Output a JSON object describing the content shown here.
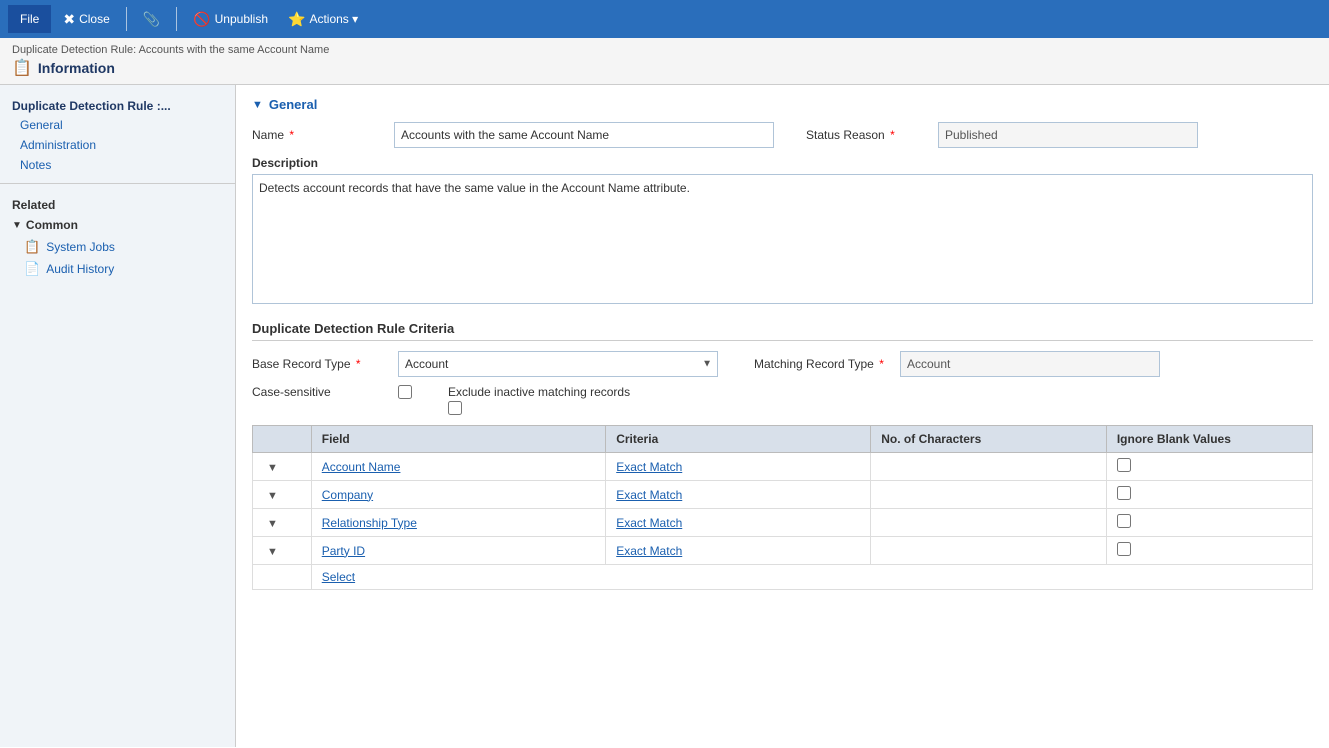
{
  "toolbar": {
    "file_label": "File",
    "close_label": "Close",
    "attachment_icon": "📎",
    "unpublish_label": "Unpublish",
    "actions_label": "Actions ▾"
  },
  "breadcrumb": {
    "text": "Duplicate Detection Rule: Accounts with the same Account Name"
  },
  "page_title": "Information",
  "sidebar": {
    "section_label": "Duplicate Detection Rule :...",
    "nav_items": [
      {
        "label": "General"
      },
      {
        "label": "Administration"
      },
      {
        "label": "Notes"
      }
    ],
    "related_label": "Related",
    "common_label": "Common",
    "common_items": [
      {
        "label": "System Jobs",
        "icon": "📋"
      },
      {
        "label": "Audit History",
        "icon": "📄"
      }
    ]
  },
  "general_section": {
    "title": "General",
    "name_label": "Name",
    "name_value": "Accounts with the same Account Name",
    "status_label": "Status Reason",
    "status_value": "Published",
    "description_label": "Description",
    "description_value": "Detects account records that have the same value in the Account Name attribute."
  },
  "criteria_section": {
    "title": "Duplicate Detection Rule Criteria",
    "base_record_label": "Base Record Type",
    "base_record_value": "Account",
    "matching_record_label": "Matching Record Type",
    "matching_record_value": "Account",
    "case_sensitive_label": "Case-sensitive",
    "exclude_inactive_label": "Exclude inactive matching records",
    "table_headers": [
      "",
      "Field",
      "Criteria",
      "No. of Characters",
      "Ignore Blank Values"
    ],
    "table_rows": [
      {
        "field": "Account Name",
        "criteria": "Exact Match"
      },
      {
        "field": "Company",
        "criteria": "Exact Match"
      },
      {
        "field": "Relationship Type",
        "criteria": "Exact Match"
      },
      {
        "field": "Party ID",
        "criteria": "Exact Match"
      }
    ],
    "select_label": "Select"
  }
}
